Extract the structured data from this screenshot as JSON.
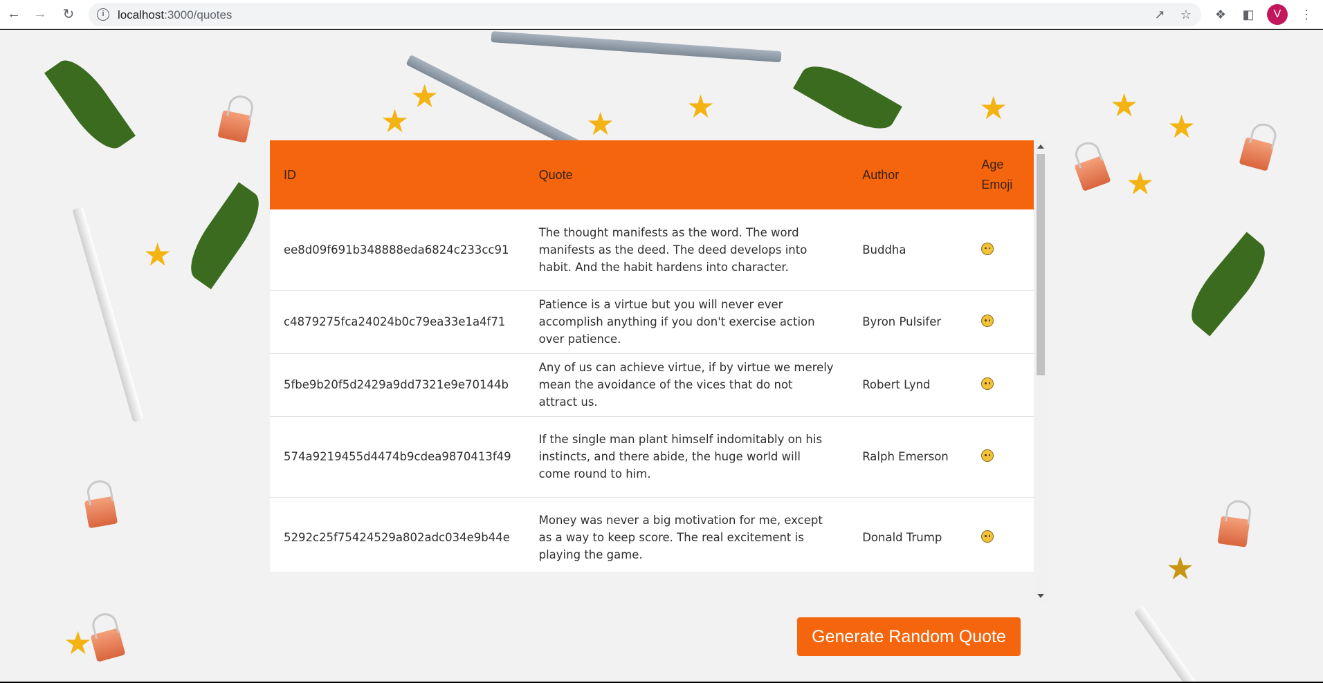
{
  "browser": {
    "url_host": "localhost",
    "url_rest": ":3000/quotes",
    "avatar_initial": "V"
  },
  "table": {
    "headers": {
      "id": "ID",
      "quote": "Quote",
      "author": "Author",
      "age_emoji_line1": "Age",
      "age_emoji_line2": "Emoji"
    },
    "rows": [
      {
        "id": "ee8d09f691b348888eda6824c233cc91",
        "quote": "The thought manifests as the word. The word manifests as the deed. The deed develops into habit. And the habit hardens into character.",
        "author": "Buddha"
      },
      {
        "id": "c4879275fca24024b0c79ea33e1a4f71",
        "quote": "Patience is a virtue but you will never ever accomplish anything if you don't exercise action over patience.",
        "author": "Byron Pulsifer"
      },
      {
        "id": "5fbe9b20f5d2429a9dd7321e9e70144b",
        "quote": "Any of us can achieve virtue, if by virtue we merely mean the avoidance of the vices that do not attract us.",
        "author": "Robert Lynd"
      },
      {
        "id": "574a9219455d4474b9cdea9870413f49",
        "quote": "If the single man plant himself indomitably on his instincts, and there abide, the huge world will come round to him.",
        "author": "Ralph Emerson"
      },
      {
        "id": "5292c25f75424529a802adc034e9b44e",
        "quote": "Money was never a big motivation for me, except as a way to keep score. The real excitement is playing the game.",
        "author": "Donald Trump"
      }
    ]
  },
  "actions": {
    "generate_label": "Generate Random Quote"
  },
  "colors": {
    "accent": "#f5650d",
    "star": "#f3b312",
    "avatar": "#c2185b"
  }
}
